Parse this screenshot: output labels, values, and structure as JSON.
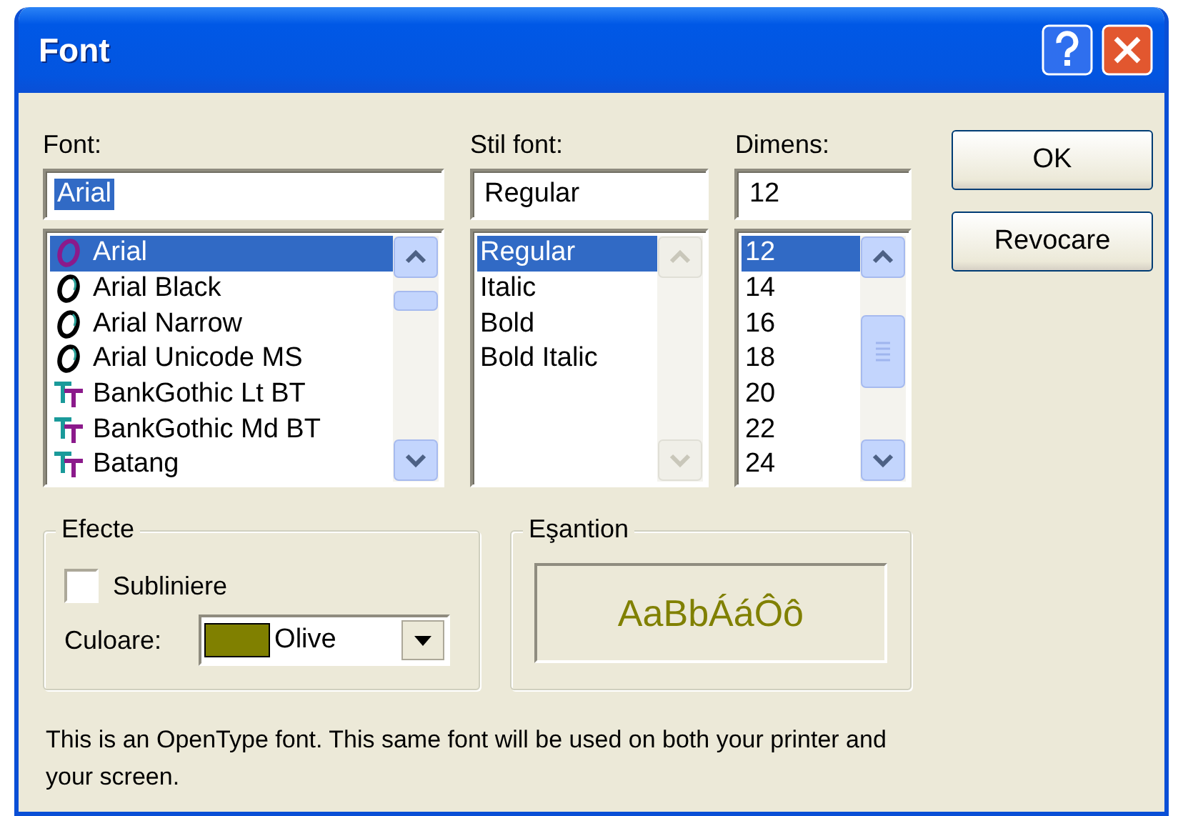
{
  "window": {
    "title": "Font"
  },
  "font": {
    "label": "Font:",
    "value": "Arial",
    "value_highlighted": true,
    "scrollable": true,
    "items": [
      {
        "name": "Arial",
        "kind": "opentype",
        "selected": true
      },
      {
        "name": "Arial Black",
        "kind": "opentype",
        "selected": false
      },
      {
        "name": "Arial Narrow",
        "kind": "opentype",
        "selected": false
      },
      {
        "name": "Arial Unicode MS",
        "kind": "opentype",
        "selected": false
      },
      {
        "name": "BankGothic Lt BT",
        "kind": "truetype",
        "selected": false
      },
      {
        "name": "BankGothic Md BT",
        "kind": "truetype",
        "selected": false
      },
      {
        "name": "Batang",
        "kind": "truetype",
        "selected": false
      }
    ]
  },
  "style": {
    "label": "Stil font:",
    "value": "Regular",
    "value_highlighted": false,
    "scrollable": false,
    "items": [
      {
        "name": "Regular",
        "selected": true
      },
      {
        "name": "Italic",
        "selected": false
      },
      {
        "name": "Bold",
        "selected": false
      },
      {
        "name": "Bold Italic",
        "selected": false
      }
    ]
  },
  "size": {
    "label": "Dimens:",
    "value": "12",
    "value_highlighted": false,
    "scrollable": true,
    "items": [
      {
        "name": "12",
        "selected": true
      },
      {
        "name": "14",
        "selected": false
      },
      {
        "name": "16",
        "selected": false
      },
      {
        "name": "18",
        "selected": false
      },
      {
        "name": "20",
        "selected": false
      },
      {
        "name": "22",
        "selected": false
      },
      {
        "name": "24",
        "selected": false
      }
    ]
  },
  "buttons": [
    "OK",
    "Revocare"
  ],
  "effects": {
    "title": "Efecte",
    "underline": {
      "label": "Subliniere",
      "checked": false
    },
    "color": {
      "label": "Culoare:",
      "value": "Olive",
      "color": "#808000"
    }
  },
  "sample": {
    "title": "Eşantion",
    "text": "AaBbÁáÔô"
  },
  "description": "This is an OpenType font. This same font will be used on both your printer and your screen."
}
